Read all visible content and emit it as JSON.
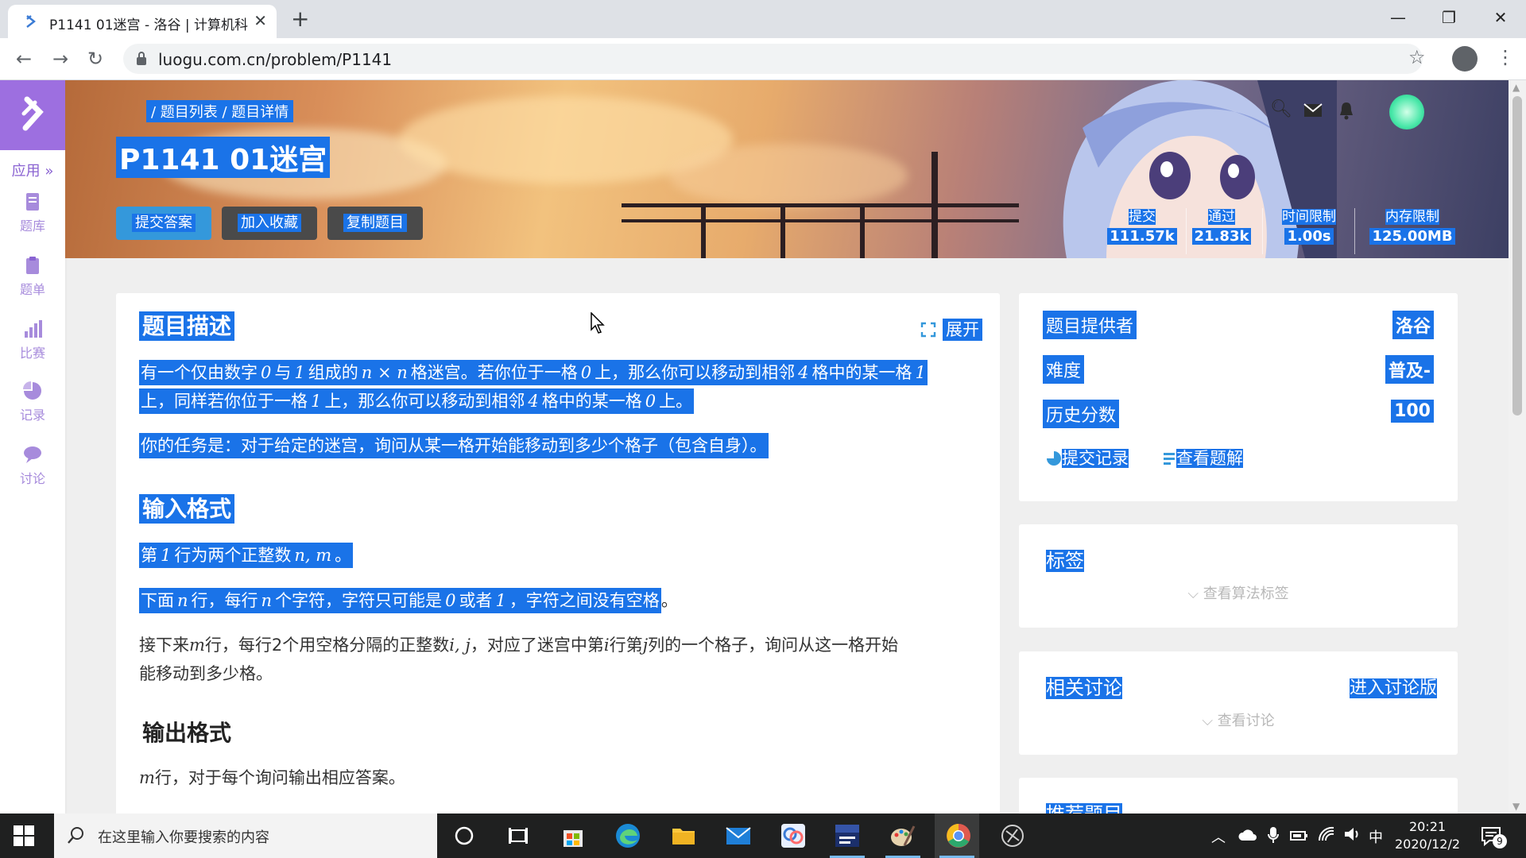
{
  "browser": {
    "tab_title": "P1141 01迷宫 - 洛谷 | 计算机科",
    "tab_close": "✕",
    "new_tab": "+",
    "url": "luogu.com.cn/problem/P1141",
    "window_min": "—",
    "window_restore": "❐",
    "window_close": "✕"
  },
  "sidebar": {
    "apps_label": "应用 »",
    "items": [
      {
        "label": "题库",
        "icon": "book-icon"
      },
      {
        "label": "题单",
        "icon": "clipboard-icon"
      },
      {
        "label": "比赛",
        "icon": "bar-chart-icon"
      },
      {
        "label": "记录",
        "icon": "pie-chart-icon"
      },
      {
        "label": "讨论",
        "icon": "chat-icon"
      }
    ]
  },
  "banner": {
    "breadcrumb": "/ 题目列表 / 题目详情",
    "title": "P1141 01迷宫",
    "buttons": {
      "submit": "提交答案",
      "favorite": "加入收藏",
      "copy": "复制题目"
    },
    "stats": [
      {
        "label": "提交",
        "value": "111.57k"
      },
      {
        "label": "通过",
        "value": "21.83k"
      },
      {
        "label": "时间限制",
        "value": "1.00s"
      },
      {
        "label": "内存限制",
        "value": "125.00MB"
      }
    ],
    "accent_color": "#3498db"
  },
  "main": {
    "expand": "展开",
    "description_heading": "题目描述",
    "desc_p1_a": "有一个仅由数字",
    "desc_p1_b": "0",
    "desc_p1_c": "与",
    "desc_p1_d": "1",
    "desc_p1_e": "组成的",
    "desc_p1_f": "n × n",
    "desc_p1_g": "格迷宫。若你位于一格",
    "desc_p1_h": "0",
    "desc_p1_i": "上，那么你可以移动到相邻",
    "desc_p1_j": "4",
    "desc_p1_k": "格中的某一格",
    "desc_p1_l": "1",
    "desc_p1_line2_a": "上，同样若你位于一格",
    "desc_p1_line2_b": "1",
    "desc_p1_line2_c": "上，那么你可以移动到相邻",
    "desc_p1_line2_d": "4",
    "desc_p1_line2_e": "格中的某一格",
    "desc_p1_line2_f": "0",
    "desc_p1_line2_g": "上。",
    "desc_p2": "你的任务是：对于给定的迷宫，询问从某一格开始能移动到多少个格子（包含自身）。",
    "input_heading": "输入格式",
    "input_p1_a": "第",
    "input_p1_b": "1",
    "input_p1_c": "行为两个正整数",
    "input_p1_d": "n, m",
    "input_p1_e": "。",
    "input_p2_a": "下面",
    "input_p2_b": "n",
    "input_p2_c": "行，每行",
    "input_p2_d": "n",
    "input_p2_e": "个字符，字符只可能是",
    "input_p2_f": "0",
    "input_p2_g": "或者",
    "input_p2_h": "1",
    "input_p2_i": "，字符之间没有空格",
    "input_p2_j": "。",
    "input_p3_a": "接下来",
    "input_p3_b": "m",
    "input_p3_c": "行，每行2个用空格分隔的正整数",
    "input_p3_d": "i, j",
    "input_p3_e": "，对应了迷宫中第",
    "input_p3_f": "i",
    "input_p3_g": "行第",
    "input_p3_h": "j",
    "input_p3_i": "列的一个格子，询问从这一格开始",
    "input_p3_line2": "能移动到多少格。",
    "output_heading": "输出格式",
    "output_p1_a": "m",
    "output_p1_b": "行，对于每个询问输出相应答案。"
  },
  "info_card": {
    "rows": [
      {
        "label": "题目提供者",
        "value": "洛谷"
      },
      {
        "label": "难度",
        "value": "普及-"
      },
      {
        "label": "历史分数",
        "value": "100"
      }
    ],
    "submit_records": "提交记录",
    "view_solutions": "查看题解"
  },
  "tags_card": {
    "title": "标签",
    "show_tags": "查看算法标签"
  },
  "discuss_card": {
    "title": "相关讨论",
    "enter": "进入讨论版",
    "show": "查看讨论"
  },
  "recommend_card": {
    "title": "推荐题目"
  },
  "taskbar": {
    "search_placeholder": "在这里输入你要搜索的内容",
    "ime": "中",
    "time": "20:21",
    "date": "2020/12/2",
    "notif_count": "9"
  }
}
